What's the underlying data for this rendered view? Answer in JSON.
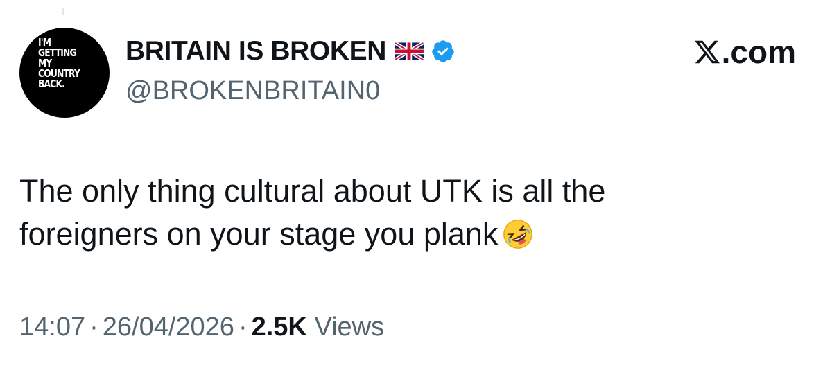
{
  "avatar": {
    "lines": [
      "I'M",
      "GETTING",
      "MY",
      "COUNTRY",
      "BACK."
    ]
  },
  "author": {
    "display_name": "BRITAIN IS BROKEN",
    "handle": "@BROKENBRITAIN0",
    "flag_icon": "uk-flag-icon",
    "verified_icon": "verified-badge-icon",
    "verified_color": "#1d9bf0"
  },
  "brand": {
    "label": ".com",
    "icon": "x-logo-icon"
  },
  "tweet": {
    "lines": [
      "The only thing cultural about UTK is all the",
      "foreigners on your stage you plank"
    ],
    "emoji_icon": "rolling-on-floor-laughing-icon"
  },
  "meta": {
    "time": "14:07",
    "separator": "·",
    "date": "26/04/2026",
    "views_count": "2.5K",
    "views_label": "Views"
  },
  "colors": {
    "text": "#0f1419",
    "secondary": "#536471",
    "avatar_bg": "#000000"
  }
}
